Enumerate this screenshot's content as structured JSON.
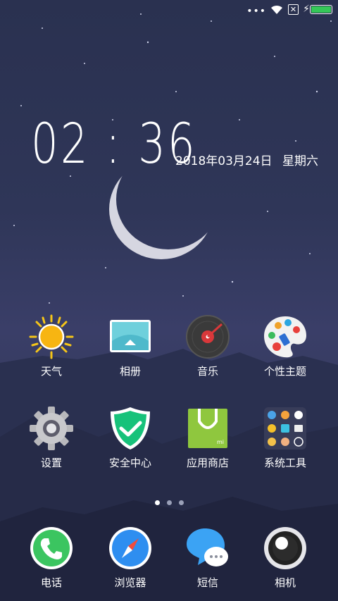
{
  "status_bar": {
    "dots": "•••",
    "battery_color": "#35c758"
  },
  "lock": {
    "time": "02:36",
    "date": "2018年03月24日",
    "weekday": "星期六"
  },
  "apps": [
    {
      "label": "天气",
      "icon": "weather-sun-icon"
    },
    {
      "label": "相册",
      "icon": "gallery-icon"
    },
    {
      "label": "音乐",
      "icon": "music-icon"
    },
    {
      "label": "个性主题",
      "icon": "themes-icon"
    },
    {
      "label": "设置",
      "icon": "settings-gear-icon"
    },
    {
      "label": "安全中心",
      "icon": "security-shield-icon"
    },
    {
      "label": "应用商店",
      "icon": "app-store-bag-icon"
    },
    {
      "label": "系统工具",
      "icon": "tools-folder-icon"
    }
  ],
  "page_indicator": {
    "count": 3,
    "active": 1
  },
  "dock": [
    {
      "label": "电话",
      "icon": "phone-icon"
    },
    {
      "label": "浏览器",
      "icon": "browser-compass-icon"
    },
    {
      "label": "短信",
      "icon": "messages-icon"
    },
    {
      "label": "相机",
      "icon": "camera-icon"
    }
  ]
}
